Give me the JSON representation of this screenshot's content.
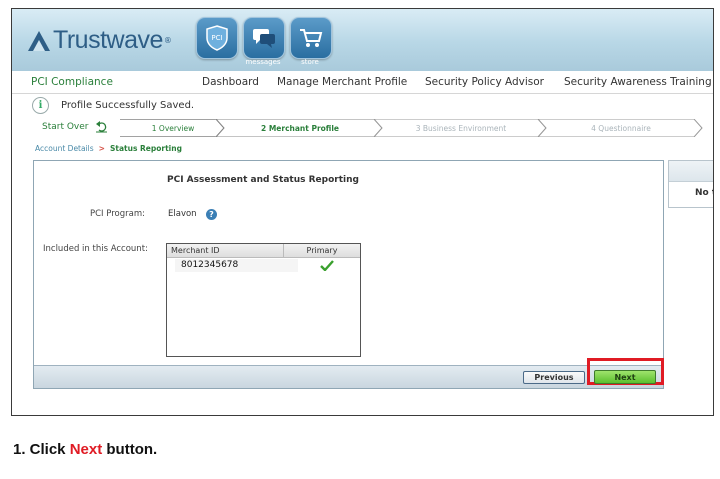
{
  "header": {
    "logo_text": "Trustwave",
    "logo_reg": "®",
    "icons": [
      {
        "name": "pci-shield-icon",
        "badge": "PCI",
        "label": ""
      },
      {
        "name": "messages-icon",
        "label": "messages"
      },
      {
        "name": "store-cart-icon",
        "label": "store"
      }
    ]
  },
  "nav": {
    "app_title": "PCI Compliance",
    "items": [
      "Dashboard",
      "Manage Merchant Profile",
      "Security Policy Advisor",
      "Security Awareness Training"
    ]
  },
  "message": {
    "icon_glyph": "i",
    "text": "Profile Successfully Saved."
  },
  "steps": {
    "start_over": "Start Over",
    "items": [
      {
        "label": "1 Overview",
        "state": "done"
      },
      {
        "label": "2 Merchant Profile",
        "state": "current"
      },
      {
        "label": "3 Business Environment",
        "state": "upcoming"
      },
      {
        "label": "4 Questionnaire",
        "state": "upcoming"
      }
    ]
  },
  "breadcrumb": {
    "link": "Account Details",
    "sep": ">",
    "current": "Status Reporting"
  },
  "panel": {
    "title": "PCI Assessment and Status Reporting",
    "program_label": "PCI Program:",
    "program_value": "Elavon",
    "help_glyph": "?",
    "included_label": "Included in this Account:",
    "table": {
      "col_merchant": "Merchant ID",
      "col_primary": "Primary",
      "rows": [
        {
          "merchant_id": "8012345678",
          "primary": true
        }
      ]
    }
  },
  "footer": {
    "previous_label": "Previous",
    "next_label": "Next"
  },
  "side_panel": {
    "text": "No t"
  },
  "caption": {
    "prefix": "1. Click ",
    "highlight": "Next",
    "suffix": " button."
  },
  "colors": {
    "accent_green": "#2a7f3a",
    "highlight_red": "#e01b24",
    "brand_blue": "#2e5e86"
  }
}
